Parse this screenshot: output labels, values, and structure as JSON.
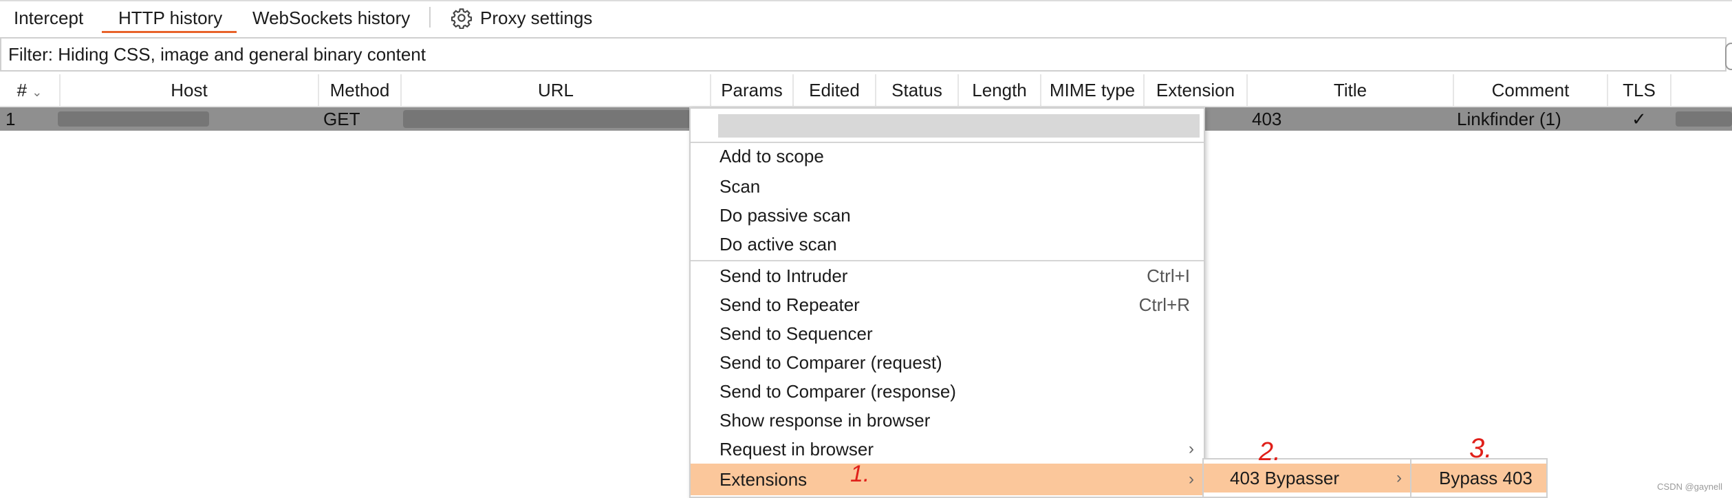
{
  "tabs": [
    {
      "label": "Intercept"
    },
    {
      "label": "HTTP history"
    },
    {
      "label": "WebSockets history"
    },
    {
      "label": "Proxy settings"
    }
  ],
  "filter": {
    "text": "Filter: Hiding CSS, image and general binary content"
  },
  "table": {
    "columns": [
      "#",
      "Host",
      "Method",
      "URL",
      "Params",
      "Edited",
      "Status",
      "Length",
      "MIME type",
      "Extension",
      "Title",
      "Comment",
      "TLS"
    ],
    "rows": [
      {
        "num": "1",
        "method": "GET",
        "title": "403",
        "comment": "Linkfinder (1)",
        "tls": "✓"
      }
    ]
  },
  "context_menu": {
    "items": [
      {
        "label": "Add to scope"
      },
      {
        "label": "Scan"
      },
      {
        "label": "Do passive scan"
      },
      {
        "label": "Do active scan"
      },
      {
        "label": "Send to Intruder",
        "shortcut": "Ctrl+I"
      },
      {
        "label": "Send to Repeater",
        "shortcut": "Ctrl+R"
      },
      {
        "label": "Send to Sequencer"
      },
      {
        "label": "Send to Comparer (request)"
      },
      {
        "label": "Send to Comparer (response)"
      },
      {
        "label": "Show response in browser"
      },
      {
        "label": "Request in browser"
      },
      {
        "label": "Extensions"
      }
    ]
  },
  "submenu_1": {
    "label": "403 Bypasser"
  },
  "submenu_2": {
    "label": "Bypass 403"
  },
  "annotations": [
    "1.",
    "2.",
    "3."
  ],
  "watermark": "CSDN @gaynell",
  "colors": {
    "accent": "#e8622a",
    "highlight": "#fbc79b",
    "row_selected": "#8f8f8f",
    "annotation": "#e0201a"
  }
}
